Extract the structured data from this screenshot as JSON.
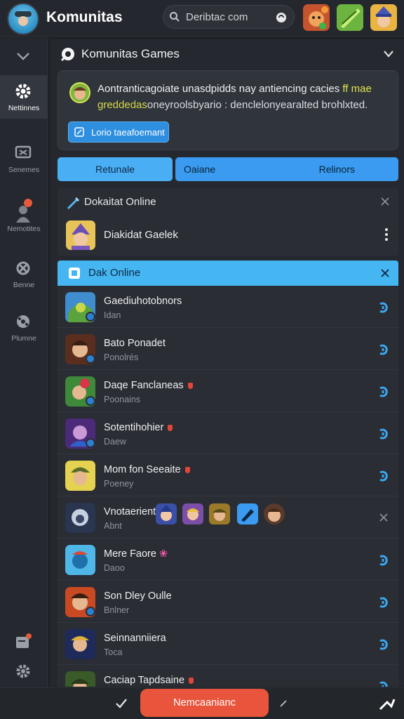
{
  "header": {
    "app_title": "Komunitas",
    "search_value": "Deribtac com",
    "logo_icon": "cowboy-avatar-icon",
    "avatar_icons": [
      "fox-character-avatar",
      "green-leaf-avatar",
      "wizard-character-avatar"
    ]
  },
  "rail": {
    "items": [
      {
        "label": "",
        "icon": "chevron-down-icon"
      },
      {
        "label": "Nettinnes",
        "icon": "gear-icon",
        "active": true
      },
      {
        "label": "Senemes",
        "icon": "chat-icon"
      },
      {
        "label": "Nemotites",
        "icon": "person-icon"
      },
      {
        "label": "Benne",
        "icon": "puzzle-icon"
      },
      {
        "label": "Plumne",
        "icon": "gamepad-icon"
      }
    ],
    "bottom_icons": [
      "notification-icon",
      "settings-icon"
    ]
  },
  "main": {
    "title": "Komunitas Games",
    "notice": {
      "line1_a": "Aontranticagoiate unasdpidds nay antiencing cacies ",
      "line1_b": "ff mae",
      "line2_a": "greddedas",
      "line2_b": "oneyroolsbyario : denclelonyearalted brohlxted.",
      "button": "Lorio taeafoemant"
    },
    "tabs": [
      "Retunale",
      "Oaiane",
      "Relinors"
    ],
    "section_a": {
      "title": "Dokaitat Online",
      "friend": "Diakidat Gaelek"
    },
    "section_b": {
      "title": "Dak Online",
      "rows": [
        {
          "title": "Gaediuhotobnors",
          "sub": "Idan",
          "flag": false
        },
        {
          "title": "Bato Ponadet",
          "sub": "Ponolrés",
          "flag": false
        },
        {
          "title": "Daqe Fanclaneas",
          "sub": "Poonains",
          "flag": true
        },
        {
          "title": "Sotentihohier",
          "sub": "Daew",
          "flag": true
        },
        {
          "title": "Mom fon Seeaite",
          "sub": "Poeney",
          "flag": true
        },
        {
          "title": "Vnotaerient",
          "sub": "Abnt",
          "flag": false
        },
        {
          "title": "Mere Faore",
          "sub": "Daoo",
          "flag": false
        },
        {
          "title": "Son Dley Oulle",
          "sub": "Bnlner",
          "flag": false
        },
        {
          "title": "Seinnanniiera",
          "sub": "Toca",
          "flag": false
        },
        {
          "title": "Caciap Tapdsaine",
          "sub": "",
          "flag": true
        }
      ],
      "row5_emoji": "❀"
    }
  },
  "bottombar": {
    "button": "Nemcaanianc"
  },
  "colors": {
    "accent": "#45b6f2",
    "primary_button": "#e8553c",
    "background": "#1f2227"
  }
}
